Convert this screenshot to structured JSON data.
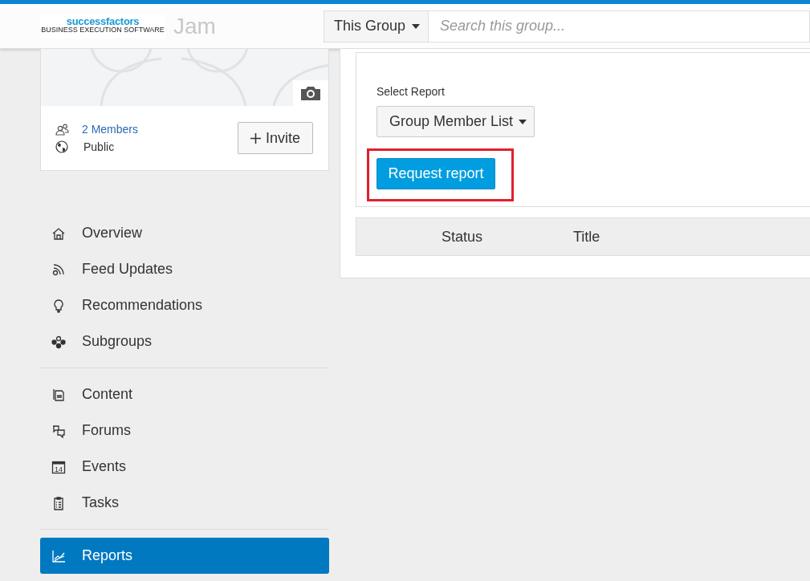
{
  "header": {
    "logo": {
      "name": "successfactors",
      "tagline": "BUSINESS EXECUTION SOFTWARE"
    },
    "app_name": "Jam",
    "scope": "This Group",
    "search": {
      "placeholder": "Search this group..."
    }
  },
  "group_card": {
    "members": "2 Members",
    "visibility": "Public",
    "invite_button": "Invite"
  },
  "sidebar": {
    "sections": [
      {
        "items": [
          {
            "label": "Overview",
            "kind": "home",
            "selected": false
          },
          {
            "label": "Feed Updates",
            "kind": "feed",
            "selected": false
          },
          {
            "label": "Recommendations",
            "kind": "bulb",
            "selected": false
          },
          {
            "label": "Subgroups",
            "kind": "subgroups",
            "selected": false
          }
        ]
      },
      {
        "items": [
          {
            "label": "Content",
            "kind": "content",
            "selected": false
          },
          {
            "label": "Forums",
            "kind": "forums",
            "selected": false
          },
          {
            "label": "Events",
            "kind": "events",
            "selected": false,
            "icon_text": "14"
          },
          {
            "label": "Tasks",
            "kind": "tasks",
            "selected": false
          }
        ]
      },
      {
        "items": [
          {
            "label": "Reports",
            "kind": "reports",
            "selected": true
          }
        ]
      }
    ]
  },
  "report_panel": {
    "select_label": "Select Report",
    "report_dropdown": "Group Member List",
    "request_button": "Request report",
    "request_highlighted": true,
    "table": {
      "columns": [
        "Status",
        "Title"
      ]
    }
  }
}
